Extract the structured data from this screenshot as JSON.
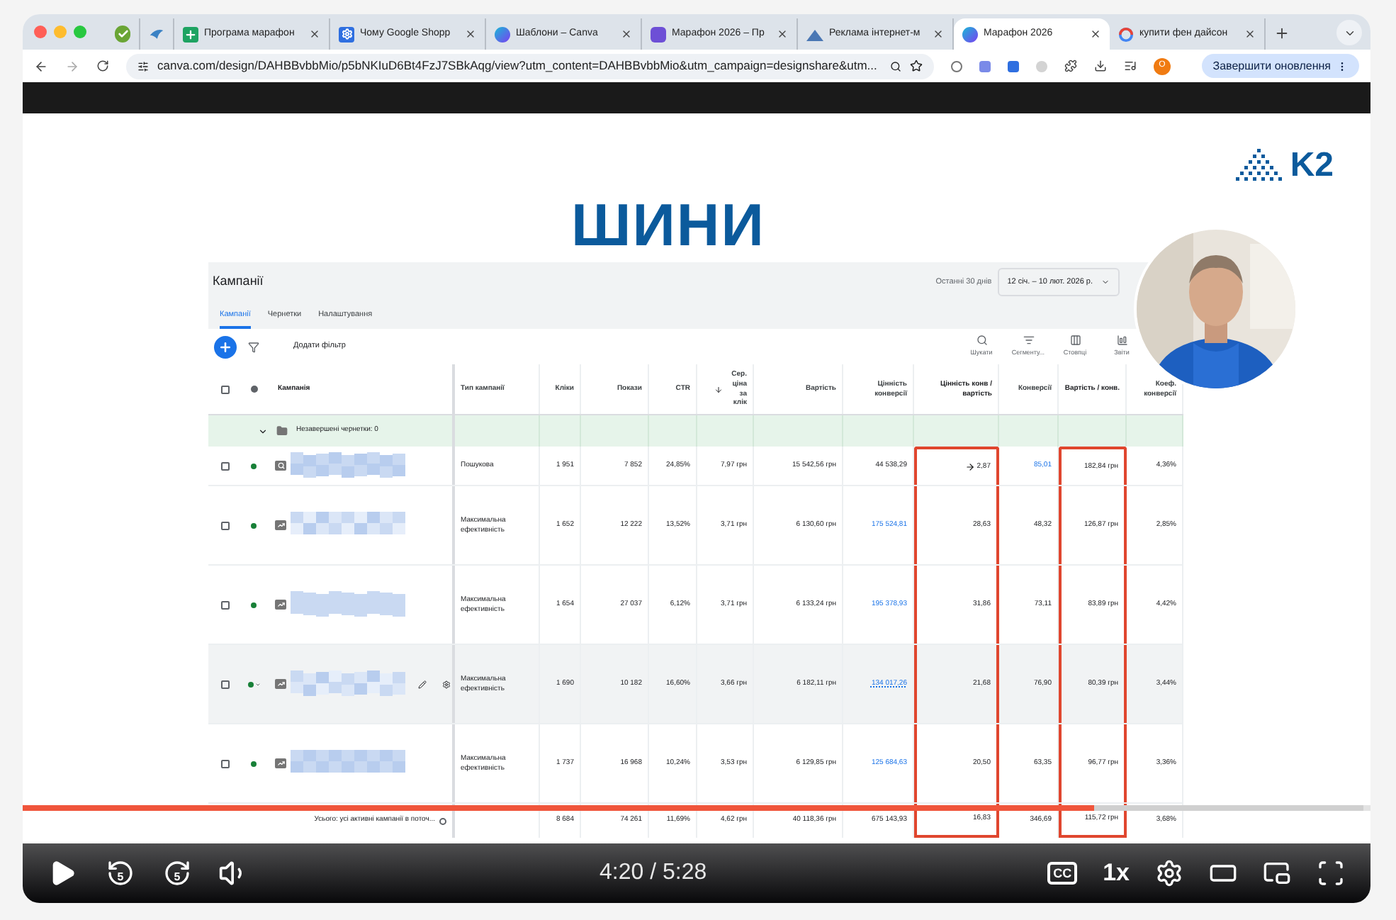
{
  "browser": {
    "tabs": [
      {
        "kind": "check",
        "selected": false
      },
      {
        "kind": "wing",
        "selected": false
      },
      {
        "title": "Програма марафон",
        "kind": "sheets",
        "selected": false
      },
      {
        "title": "Чому Google Shopp",
        "kind": "gear",
        "selected": false
      },
      {
        "title": "Шаблони – Canva",
        "kind": "canva",
        "selected": false
      },
      {
        "title": "Марафон 2026 – Пр",
        "kind": "slides",
        "selected": false
      },
      {
        "title": "Реклама інтернет-м",
        "kind": "ads",
        "selected": false
      },
      {
        "title": "Марафон 2026",
        "kind": "canva",
        "selected": true
      },
      {
        "title": "купити фен дайсон",
        "kind": "google",
        "selected": false
      }
    ],
    "url": "canva.com/design/DAHBBvbbMio/p5bNKIuD6Bt4FzJ7SBkAqg/view?utm_content=DAHBBvbbMio&utm_campaign=designshare&utm...",
    "profile": "O",
    "update_button": "Завершити оновлення"
  },
  "slide": {
    "logo": "K2",
    "title": "ШИНИ",
    "ads": {
      "page_title": "Кампанії",
      "date_label": "Останні 30 днів",
      "date_range": "12 січ. – 10 лют. 2026 р.",
      "tabs": [
        {
          "label": "Кампанії",
          "selected": true
        },
        {
          "label": "Чернетки",
          "selected": false
        },
        {
          "label": "Налаштування",
          "selected": false
        }
      ],
      "add_filter": "Додати фільтр",
      "tools": [
        {
          "label": "Шукати",
          "kind": "search"
        },
        {
          "label": "Сегменту...",
          "kind": "segment"
        },
        {
          "label": "Стовпці",
          "kind": "columns"
        },
        {
          "label": "Звіти",
          "kind": "reports"
        }
      ],
      "select_all_checked": false,
      "campaign_header": "Кампанія",
      "columns": [
        {
          "label": "Тип кампанії",
          "sorted": false,
          "highlighted": false
        },
        {
          "label": "Кліки",
          "sorted": false,
          "highlighted": false
        },
        {
          "label": "Покази",
          "sorted": false,
          "highlighted": false
        },
        {
          "label": "CTR",
          "sorted": false,
          "highlighted": false
        },
        {
          "label": "Сер. ціна за клік",
          "sorted": true,
          "highlighted": false
        },
        {
          "label": "Вартість",
          "sorted": false,
          "highlighted": false
        },
        {
          "label": "Цінність конверсії",
          "sorted": false,
          "highlighted": false
        },
        {
          "label": "Цінність конв / вартість",
          "sorted": false,
          "highlighted": true
        },
        {
          "label": "Конверсії",
          "sorted": false,
          "highlighted": false
        },
        {
          "label": "Вартість / конв.",
          "sorted": false,
          "highlighted": true
        },
        {
          "label": "Коеф. конверсії",
          "sorted": false,
          "highlighted": false
        }
      ],
      "drafts": "Незавершені чернетки: 0",
      "rows": [
        {
          "checked": false,
          "color": "#188038",
          "kind": "search",
          "hovered": false,
          "cells": [
            {
              "text": "Пошукова",
              "link": false
            },
            {
              "text": "1 951",
              "link": false
            },
            {
              "text": "7 852",
              "link": false
            },
            {
              "text": "24,85%",
              "link": false
            },
            {
              "text": "7,97 грн",
              "link": false
            },
            {
              "text": "15 542,56 грн",
              "link": false
            },
            {
              "text": "44 538,29",
              "link": false
            },
            {
              "text": "2,87",
              "link": false
            },
            {
              "text": "85,01",
              "link": true
            },
            {
              "text": "182,84 грн",
              "link": false
            },
            {
              "text": "4,36%",
              "link": false
            }
          ]
        },
        {
          "checked": false,
          "color": "#188038",
          "kind": "chart",
          "hovered": false,
          "cells": [
            {
              "text": "Максимальна ефективність",
              "link": false
            },
            {
              "text": "1 652",
              "link": false
            },
            {
              "text": "12 222",
              "link": false
            },
            {
              "text": "13,52%",
              "link": false
            },
            {
              "text": "3,71 грн",
              "link": false
            },
            {
              "text": "6 130,60 грн",
              "link": false
            },
            {
              "text": "175 524,81",
              "link": true
            },
            {
              "text": "28,63",
              "link": false
            },
            {
              "text": "48,32",
              "link": false
            },
            {
              "text": "126,87 грн",
              "link": false
            },
            {
              "text": "2,85%",
              "link": false
            }
          ]
        },
        {
          "checked": false,
          "color": "#188038",
          "kind": "chart",
          "hovered": false,
          "cells": [
            {
              "text": "Максимальна ефективність",
              "link": false
            },
            {
              "text": "1 654",
              "link": false
            },
            {
              "text": "27 037",
              "link": false
            },
            {
              "text": "6,12%",
              "link": false
            },
            {
              "text": "3,71 грн",
              "link": false
            },
            {
              "text": "6 133,24 грн",
              "link": false
            },
            {
              "text": "195 378,93",
              "link": true
            },
            {
              "text": "31,86",
              "link": false
            },
            {
              "text": "73,11",
              "link": false
            },
            {
              "text": "83,89 грн",
              "link": false
            },
            {
              "text": "4,42%",
              "link": false
            }
          ]
        },
        {
          "checked": false,
          "color": "#188038",
          "kind": "chart",
          "hovered": true,
          "cells": [
            {
              "text": "Максимальна ефективність",
              "link": false
            },
            {
              "text": "1 690",
              "link": false
            },
            {
              "text": "10 182",
              "link": false
            },
            {
              "text": "16,60%",
              "link": false
            },
            {
              "text": "3,66 грн",
              "link": false
            },
            {
              "text": "6 182,11 грн",
              "link": false
            },
            {
              "text": "134 017,26",
              "link": true
            },
            {
              "text": "21,68",
              "link": false
            },
            {
              "text": "76,90",
              "link": false
            },
            {
              "text": "80,39 грн",
              "link": false
            },
            {
              "text": "3,44%",
              "link": false
            }
          ]
        },
        {
          "checked": false,
          "color": "#188038",
          "kind": "chart",
          "hovered": false,
          "cells": [
            {
              "text": "Максимальна ефективність",
              "link": false
            },
            {
              "text": "1 737",
              "link": false
            },
            {
              "text": "16 968",
              "link": false
            },
            {
              "text": "10,24%",
              "link": false
            },
            {
              "text": "3,53 грн",
              "link": false
            },
            {
              "text": "6 129,85 грн",
              "link": false
            },
            {
              "text": "125 684,63",
              "link": true
            },
            {
              "text": "20,50",
              "link": false
            },
            {
              "text": "63,35",
              "link": false
            },
            {
              "text": "96,77 грн",
              "link": false
            },
            {
              "text": "3,36%",
              "link": false
            }
          ]
        }
      ],
      "totals": {
        "label": "Усього: усі активні кампанії в поточ...",
        "cells": [
          "",
          "8 684",
          "74 261",
          "11,69%",
          "4,62 грн",
          "40 118,36 грн",
          "675 143,93",
          "16,83",
          "346,69",
          "115,72 грн",
          "3,68%"
        ]
      }
    }
  },
  "player": {
    "progress": {
      "level": 0.795
    },
    "buffer": {
      "level": 0.995
    },
    "rewind": "5",
    "forward": "5",
    "time": "4:20 / 5:28",
    "captions": "CC",
    "speed": "1x"
  }
}
